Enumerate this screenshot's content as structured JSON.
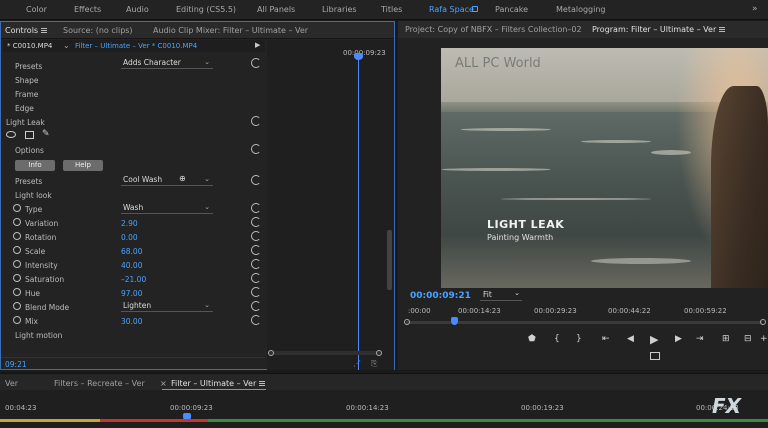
{
  "workspace_tabs": [
    "Color",
    "Effects",
    "Audio",
    "Editing (CS5.5)",
    "All Panels",
    "Libraries",
    "Titles",
    "Rafa Space",
    "Pancake",
    "Metalogging"
  ],
  "active_workspace": "Rafa Space",
  "left_panel": {
    "tabs": {
      "controls": "Controls",
      "source": "Source: (no clips)",
      "mixer": "Audio Clip Mixer: Filter – Ultimate – Ver"
    },
    "clip_master": "* C0010.MP4",
    "clip_sequence": "Filter – Ultimate – Ver  * C0010.MP4",
    "time_at_playhead": "00:00:09:23",
    "rows": {
      "presets_top_label": "Presets",
      "presets_top_value": "Adds Character",
      "shape": "Shape",
      "frame": "Frame",
      "edge": "Edge",
      "effect_name": "Light Leak",
      "options": "Options",
      "info_btn": "Info",
      "help_btn": "Help",
      "presets_label": "Presets",
      "presets_value": "Cool Wash",
      "light_look": "Light look",
      "type_label": "Type",
      "type_value": "Wash",
      "variation_label": "Variation",
      "variation_value": "2.90",
      "rotation_label": "Rotation",
      "rotation_value": "0.00",
      "scale_label": "Scale",
      "scale_value": "68.00",
      "intensity_label": "Intensity",
      "intensity_value": "40.00",
      "saturation_label": "Saturation",
      "saturation_value": "–21.00",
      "hue_label": "Hue",
      "hue_value": "97.00",
      "blend_label": "Blend Mode",
      "blend_value": "Lighten",
      "mix_label": "Mix",
      "mix_value": "30.00",
      "light_motion": "Light motion"
    },
    "current_time": "09:21"
  },
  "right_panel": {
    "project_tab": "Project: Copy of NBFX – Filters Collection–02",
    "program_tab": "Program: Filter – Ultimate – Ver",
    "watermark": "ALL PC World",
    "overlay_title": "LIGHT LEAK",
    "overlay_subtitle": "Painting Warmth",
    "timecode": "00:00:09:21",
    "fit": "Fit",
    "ruler_labels": [
      ":00:00",
      "00:00:14:23",
      "00:00:29:23",
      "00:00:44:22",
      "00:00:59:22"
    ]
  },
  "bottom": {
    "seq_tabs": [
      "Ver",
      "Filters – Recreate – Ver",
      "Filter – Ultimate – Ver"
    ],
    "ruler_labels": [
      "00:04:23",
      "00:00:09:23",
      "00:00:14:23",
      "00:00:19:23",
      "00:00:24:23"
    ]
  },
  "colors": {
    "accent": "#4aa3ff",
    "panel_border": "#3a6fb7"
  }
}
